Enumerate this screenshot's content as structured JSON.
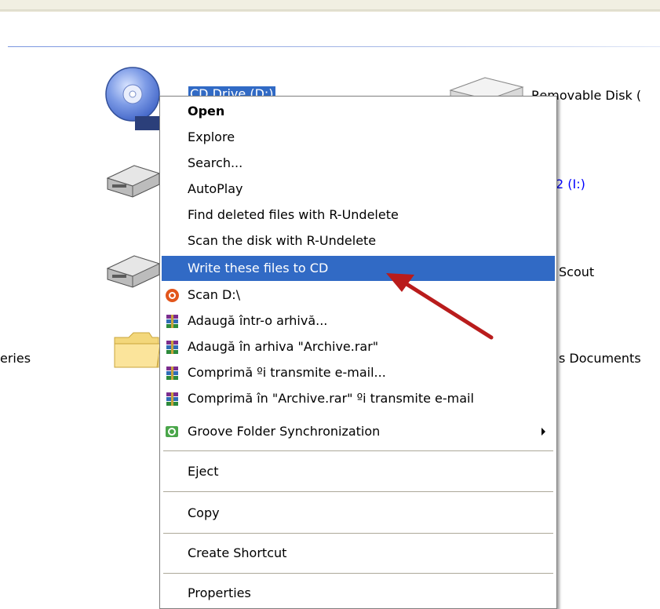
{
  "explorer": {
    "items": {
      "cd_drive_label": "CD Drive (D:)",
      "cd_badge": "CD",
      "removable_label": "Removable Disk (",
      "drive2_label": "2 (I:)",
      "drive3_label": "Scout",
      "folder_left_label": "eries",
      "folder_right_label": "s Documents"
    }
  },
  "context_menu": {
    "items": [
      {
        "label": "Open",
        "bold": true
      },
      {
        "label": "Explore"
      },
      {
        "label": "Search..."
      },
      {
        "label": "AutoPlay"
      },
      {
        "label": "Find deleted files with R-Undelete"
      },
      {
        "label": "Scan the disk with R-Undelete"
      },
      {
        "label": "Write these files to CD",
        "selected": true
      },
      {
        "label": "Scan D:\\",
        "icon": "scan-icon"
      },
      {
        "label": "Adaugă într-o arhivă...",
        "icon": "winrar-icon"
      },
      {
        "label": "Adaugă în arhiva \"Archive.rar\"",
        "icon": "winrar-icon"
      },
      {
        "label": "Comprimă ºi transmite e-mail...",
        "icon": "winrar-icon"
      },
      {
        "label": "Comprimă în \"Archive.rar\" ºi transmite e-mail",
        "icon": "winrar-icon"
      },
      {
        "label": "Groove Folder Synchronization",
        "icon": "groove-icon",
        "submenu": true
      },
      {
        "label": "Eject"
      },
      {
        "label": "Copy"
      },
      {
        "label": "Create Shortcut"
      },
      {
        "label": "Properties"
      }
    ]
  },
  "colors": {
    "selection": "#316ac5",
    "link_blue": "#0000ff",
    "annotation_arrow": "#b91c1c"
  }
}
